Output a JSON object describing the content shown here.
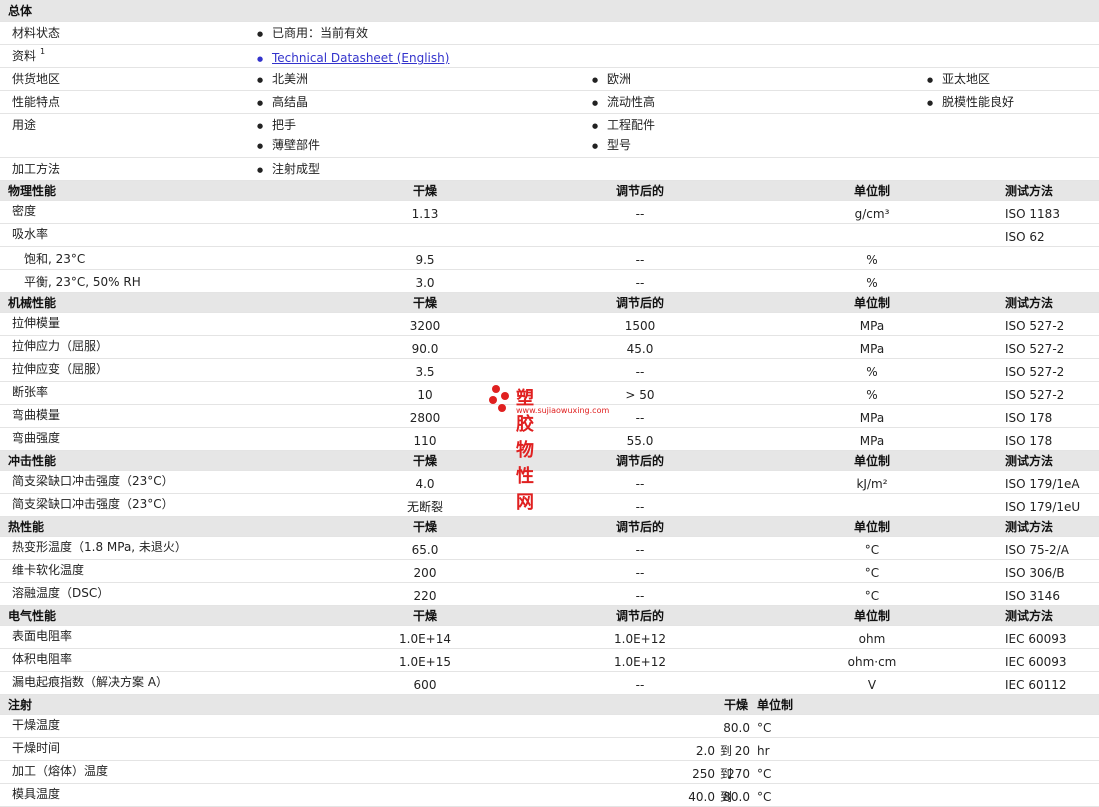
{
  "general": {
    "title": "总体",
    "rows": [
      {
        "label": "材料状态",
        "items": [
          "已商用：当前有效"
        ]
      },
      {
        "label": "资料",
        "sup": "1",
        "link": "Technical Datasheet (English)"
      },
      {
        "label": "供货地区",
        "items": [
          "北美洲",
          "欧洲",
          "亚太地区"
        ]
      },
      {
        "label": "性能特点",
        "items": [
          "高结晶",
          "流动性高",
          "脱模性能良好"
        ]
      },
      {
        "label": "用途",
        "items": [
          "把手",
          "工程配件",
          "薄壁部件",
          "型号"
        ]
      },
      {
        "label": "加工方法",
        "items": [
          "注射成型"
        ]
      }
    ]
  },
  "columns": {
    "dry": "干燥",
    "cond": "调节后的",
    "unit": "单位制",
    "method": "测试方法"
  },
  "sections": [
    {
      "title": "物理性能",
      "rows": [
        {
          "label": "密度",
          "dry": "1.13",
          "cond": "--",
          "unit": "g/cm³",
          "method": "ISO 1183"
        },
        {
          "label": "吸水率",
          "dry": "",
          "cond": "",
          "unit": "",
          "method": "ISO 62"
        },
        {
          "label": "饱和, 23°C",
          "indent": true,
          "dry": "9.5",
          "cond": "--",
          "unit": "%",
          "method": ""
        },
        {
          "label": "平衡, 23°C, 50% RH",
          "indent": true,
          "dry": "3.0",
          "cond": "--",
          "unit": "%",
          "method": ""
        }
      ]
    },
    {
      "title": "机械性能",
      "rows": [
        {
          "label": "拉伸模量",
          "dry": "3200",
          "cond": "1500",
          "unit": "MPa",
          "method": "ISO 527-2"
        },
        {
          "label": "拉伸应力（屈服）",
          "dry": "90.0",
          "cond": "45.0",
          "unit": "MPa",
          "method": "ISO 527-2"
        },
        {
          "label": "拉伸应变（屈服）",
          "dry": "3.5",
          "cond": "--",
          "unit": "%",
          "method": "ISO 527-2"
        },
        {
          "label": "断张率",
          "dry": "10",
          "cond": "> 50",
          "unit": "%",
          "method": "ISO 527-2"
        },
        {
          "label": "弯曲模量",
          "dry": "2800",
          "cond": "--",
          "unit": "MPa",
          "method": "ISO 178"
        },
        {
          "label": "弯曲强度",
          "dry": "110",
          "cond": "55.0",
          "unit": "MPa",
          "method": "ISO 178"
        }
      ]
    },
    {
      "title": "冲击性能",
      "rows": [
        {
          "label": "简支梁缺口冲击强度（23°C）",
          "dry": "4.0",
          "cond": "--",
          "unit": "kJ/m²",
          "method": "ISO 179/1eA"
        },
        {
          "label": "简支梁缺口冲击强度（23°C）",
          "dry": "无断裂",
          "cond": "--",
          "unit": "",
          "method": "ISO 179/1eU"
        }
      ]
    },
    {
      "title": "热性能",
      "rows": [
        {
          "label": "热变形温度（1.8 MPa, 未退火）",
          "dry": "65.0",
          "cond": "--",
          "unit": "°C",
          "method": "ISO 75-2/A"
        },
        {
          "label": "维卡软化温度",
          "dry": "200",
          "cond": "--",
          "unit": "°C",
          "method": "ISO 306/B"
        },
        {
          "label": "溶融温度（DSC）",
          "dry": "220",
          "cond": "--",
          "unit": "°C",
          "method": "ISO 3146"
        }
      ]
    },
    {
      "title": "电气性能",
      "rows": [
        {
          "label": "表面电阻率",
          "dry": "1.0E+14",
          "cond": "1.0E+12",
          "unit": "ohm",
          "method": "IEC 60093"
        },
        {
          "label": "体积电阻率",
          "dry": "1.0E+15",
          "cond": "1.0E+12",
          "unit": "ohm·cm",
          "method": "IEC 60093"
        },
        {
          "label": "漏电起痕指数（解决方案 A）",
          "dry": "600",
          "cond": "--",
          "unit": "V",
          "method": "IEC 60112"
        }
      ]
    }
  ],
  "injection": {
    "title": "注射",
    "col_dry": "干燥",
    "col_unit": "单位制",
    "rows": [
      {
        "label": "干燥温度",
        "value": "80.0",
        "unit": "°C"
      },
      {
        "label": "干燥时间",
        "from": "2.0",
        "to_word": "到",
        "to": "20",
        "unit": "hr"
      },
      {
        "label": "加工（熔体）温度",
        "from": "250",
        "to_word": "到",
        "to": "270",
        "unit": "°C"
      },
      {
        "label": "模具温度",
        "from": "40.0",
        "to_word": "到",
        "to": "80.0",
        "unit": "°C"
      }
    ]
  },
  "watermark": {
    "text": "塑胶物性网",
    "url": "www.sujiaowuxing.com",
    "color": "#e02020"
  }
}
